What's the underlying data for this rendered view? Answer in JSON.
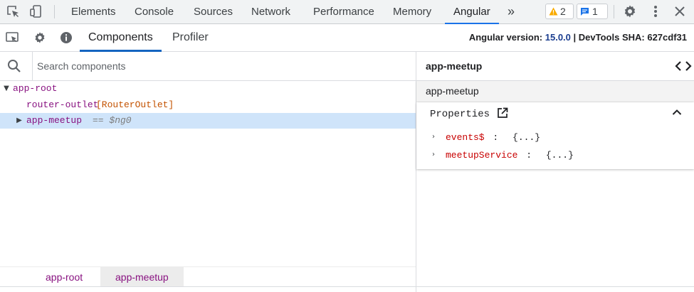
{
  "devtools": {
    "tabs": [
      "Elements",
      "Console",
      "Sources",
      "Network",
      "Performance",
      "Memory",
      "Angular"
    ],
    "active_tab": "Angular",
    "more_tabs": "»",
    "warnings_count": "2",
    "messages_count": "1"
  },
  "angular": {
    "tabs": [
      "Components",
      "Profiler"
    ],
    "active_tab": "Components",
    "version_label": "Angular version:",
    "version": "15.0.0",
    "sha_label": "| DevTools SHA:",
    "sha": "627cdf31"
  },
  "search": {
    "placeholder": "Search components",
    "value": ""
  },
  "tree": [
    {
      "name": "app-root",
      "directive": "",
      "ref": "",
      "expanded": true,
      "selected": false
    },
    {
      "name": "router-outlet",
      "directive": "[RouterOutlet]",
      "ref": "",
      "expanded": false,
      "selected": false
    },
    {
      "name": "app-meetup",
      "directive": "",
      "ref": "== $ng0",
      "expanded": false,
      "selected": true
    }
  ],
  "breadcrumbs": [
    {
      "label": "app-root",
      "active": false
    },
    {
      "label": "app-meetup",
      "active": true
    }
  ],
  "details": {
    "title": "app-meetup",
    "component": "app-meetup",
    "section_title": "Properties",
    "properties": [
      {
        "key": "events$",
        "sep": ":",
        "value": "{...}"
      },
      {
        "key": "meetupService",
        "sep": ":",
        "value": "{...}"
      }
    ]
  },
  "colors": {
    "accent": "#1a73e8",
    "tag": "#881280",
    "directive": "#c35200",
    "property_key": "#c80000",
    "selection": "#cfe4fa"
  },
  "icons": {
    "inspect": "inspect-element-icon",
    "device": "device-toolbar-icon",
    "warning": "warning-icon",
    "message": "message-icon",
    "settings": "gear-icon",
    "menu": "kebab-menu-icon",
    "close": "close-icon",
    "search": "search-icon",
    "info": "info-icon",
    "open_source": "open-in-new-icon",
    "collapse": "chevron-up-icon",
    "view_source": "code-brackets-icon"
  }
}
